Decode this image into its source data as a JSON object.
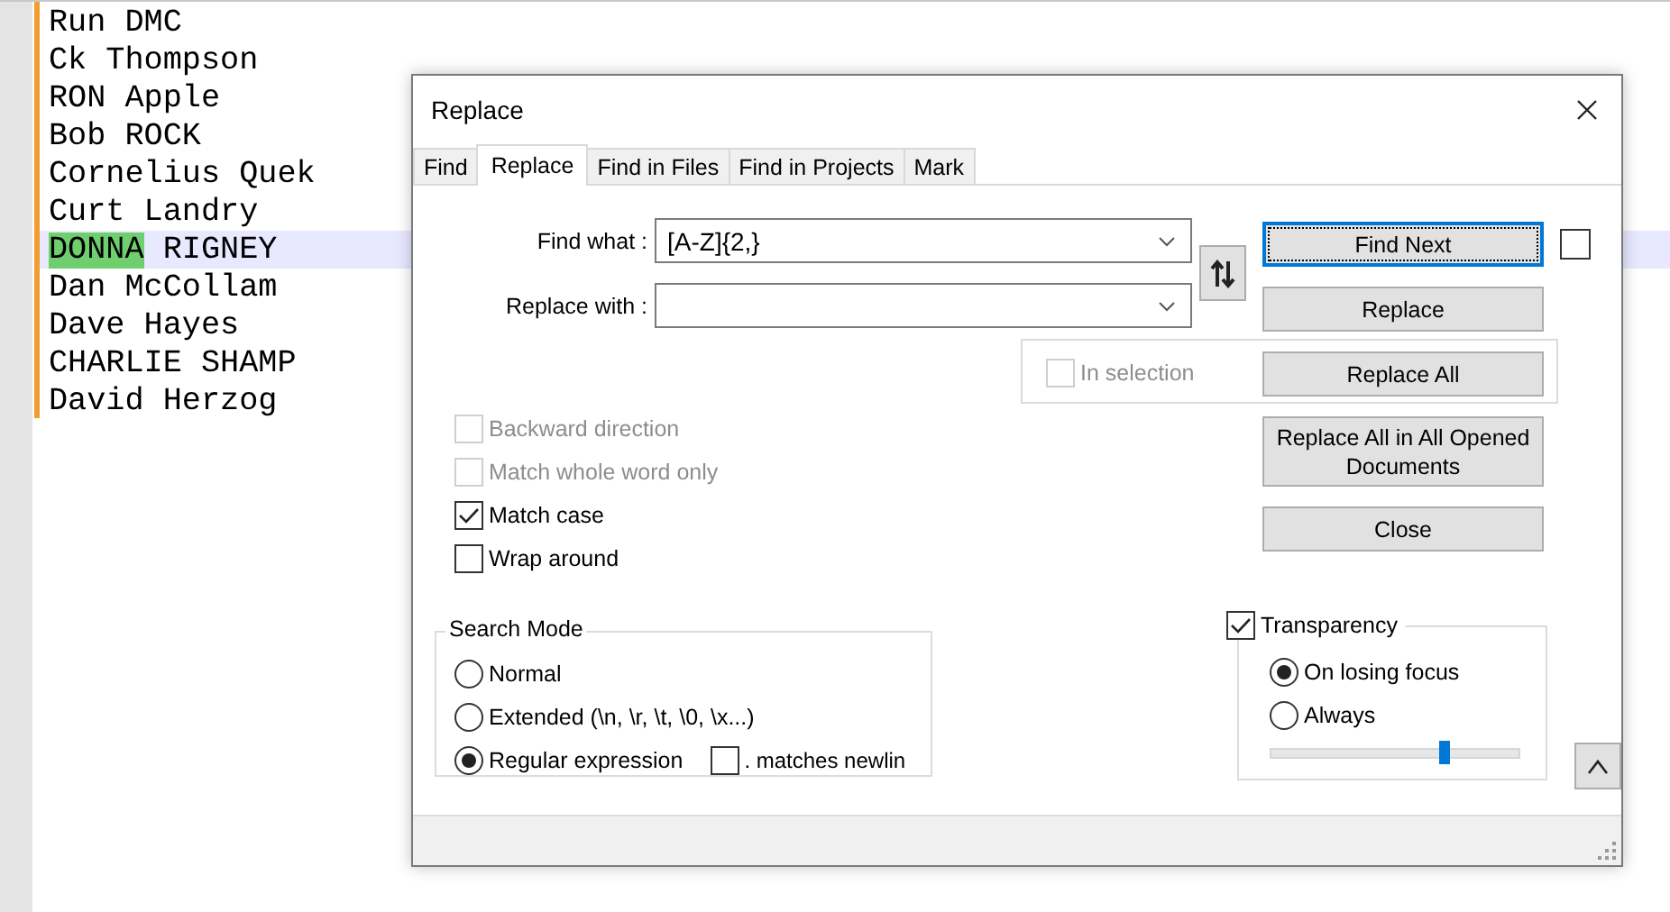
{
  "editor": {
    "lines": [
      {
        "current": false,
        "segments": [
          {
            "text": "Run DMC",
            "match": false
          }
        ]
      },
      {
        "current": false,
        "segments": [
          {
            "text": "Ck Thompson",
            "match": false
          }
        ]
      },
      {
        "current": false,
        "segments": [
          {
            "text": "RON Apple",
            "match": false
          }
        ]
      },
      {
        "current": false,
        "segments": [
          {
            "text": "Bob ROCK",
            "match": false
          }
        ]
      },
      {
        "current": false,
        "segments": [
          {
            "text": "Cornelius Quek",
            "match": false
          }
        ]
      },
      {
        "current": false,
        "segments": [
          {
            "text": "Curt Landry",
            "match": false
          }
        ]
      },
      {
        "current": true,
        "segments": [
          {
            "text": "DONNA",
            "match": true
          },
          {
            "text": " RIGNEY",
            "match": false
          }
        ]
      },
      {
        "current": false,
        "segments": [
          {
            "text": "Dan McCollam",
            "match": false
          }
        ]
      },
      {
        "current": false,
        "segments": [
          {
            "text": "Dave Hayes",
            "match": false
          }
        ]
      },
      {
        "current": false,
        "segments": [
          {
            "text": "CHARLIE SHAMP",
            "match": false
          }
        ]
      },
      {
        "current": false,
        "segments": [
          {
            "text": "David Herzog",
            "match": false
          }
        ]
      }
    ]
  },
  "dialog": {
    "title": "Replace",
    "tabs": [
      {
        "label": "Find",
        "selected": false
      },
      {
        "label": "Replace",
        "selected": true
      },
      {
        "label": "Find in Files",
        "selected": false
      },
      {
        "label": "Find in Projects",
        "selected": false
      },
      {
        "label": "Mark",
        "selected": false
      }
    ],
    "find_what": {
      "label": "Find what :",
      "value": "[A-Z]{2,}"
    },
    "replace_with": {
      "label": "Replace with :"
    },
    "buttons": [
      {
        "label": "Find Next",
        "focused": true
      },
      {
        "label": "Replace",
        "focused": false
      },
      {
        "label": "Replace All",
        "focused": false
      },
      {
        "label": "Replace All in All Opened Documents",
        "focused": false
      },
      {
        "label": "Close",
        "focused": false
      }
    ],
    "side_checkbox": {
      "checked": false
    },
    "in_selection": {
      "label": "In selection",
      "checked": false,
      "disabled": true
    },
    "options": [
      {
        "label": "Backward direction",
        "checked": false,
        "disabled": true
      },
      {
        "label": "Match whole word only",
        "checked": false,
        "disabled": true
      },
      {
        "label": "Match case",
        "checked": true,
        "disabled": false
      },
      {
        "label": "Wrap around",
        "checked": false,
        "disabled": false
      }
    ],
    "search_mode": {
      "title": "Search Mode",
      "options": [
        {
          "label": "Normal",
          "selected": false
        },
        {
          "label": "Extended (\\n, \\r, \\t, \\0, \\x...)",
          "selected": false
        },
        {
          "label": "Regular expression",
          "selected": true
        }
      ],
      "dot_matches_newline": {
        "label": ". matches newlin",
        "checked": false
      }
    },
    "transparency": {
      "label": "Transparency",
      "checked": true,
      "options": [
        {
          "label": "On losing focus",
          "selected": true
        },
        {
          "label": "Always",
          "selected": false
        }
      ],
      "level": 0.7
    }
  }
}
